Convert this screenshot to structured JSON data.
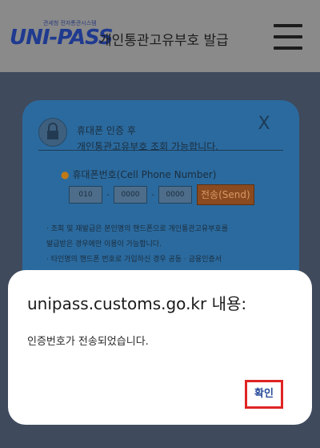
{
  "header": {
    "logo_subtext": "관세청 전자통관시스템",
    "logo_text": "UNI-PASS",
    "title": "개인통관고유부호  발급"
  },
  "background_modal": {
    "title_line1": "휴대폰 인증 후",
    "title_line2": "개인통관고유부호 조회 가능합니다.",
    "close_symbol": "X",
    "phone_label": "휴대폰번호(Cell Phone Number)",
    "phone_fields": [
      "010",
      "0000",
      "0000"
    ],
    "send_button": "전송(Send)",
    "notice_lines": [
      "· 조회 및 재발급은 본인명의 핸드폰으로 개인통관고유부호를",
      "발급받은 경우에만 이용이 가능합니다.",
      "· 타인명의 핸드폰 번호로 가입하신 경우 공동 · 금융인증서"
    ]
  },
  "alert": {
    "title": "unipass.customs.go.kr 내용:",
    "message": "인증번호가 전송되었습니다.",
    "confirm_label": "확인"
  },
  "colors": {
    "overlay": "#3f4a5d",
    "modal": "#2b6a9e",
    "send_button": "#8a4a1f",
    "confirm_highlight": "#e02424",
    "confirm_text": "#274a9a"
  }
}
